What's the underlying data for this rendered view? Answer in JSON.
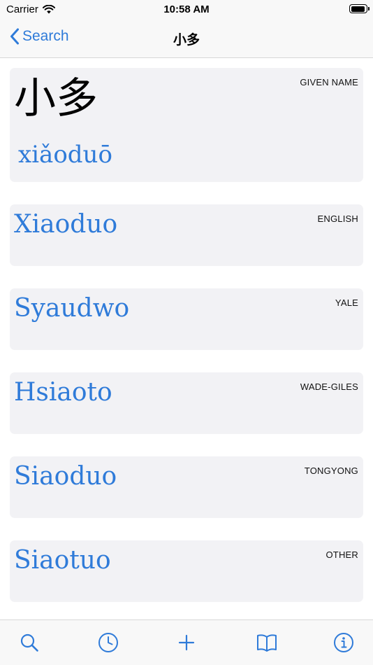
{
  "status_bar": {
    "carrier": "Carrier",
    "time": "10:58 AM",
    "battery_level": 0.95
  },
  "nav": {
    "back_label": "Search",
    "title": "小多"
  },
  "entry": {
    "tag": "GIVEN NAME",
    "hanzi": "小多",
    "pinyin": "xiǎoduō"
  },
  "romanizations": [
    {
      "tag": "ENGLISH",
      "value": "Xiaoduo"
    },
    {
      "tag": "YALE",
      "value": "Syaudwo"
    },
    {
      "tag": "WADE-GILES",
      "value": "Hsiaoto"
    },
    {
      "tag": "TONGYONG",
      "value": "Siaoduo"
    },
    {
      "tag": "OTHER",
      "value": "Siaotuo"
    }
  ],
  "tab_icons": [
    "search-icon",
    "clock-icon",
    "plus-icon",
    "book-icon",
    "info-icon"
  ],
  "colors": {
    "accent": "#2f7bd9",
    "card_bg": "#f2f2f5",
    "bar_bg": "#f8f8f8"
  }
}
